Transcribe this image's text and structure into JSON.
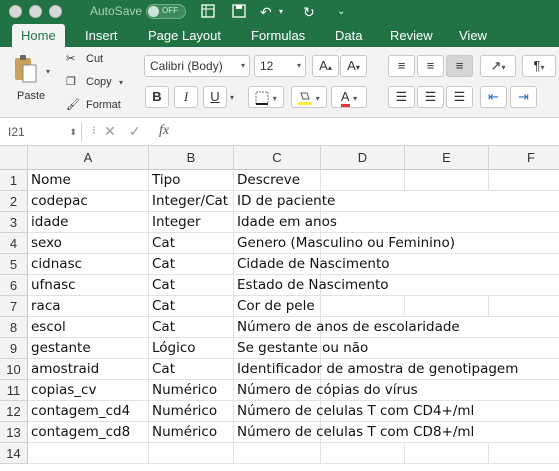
{
  "titlebar": {
    "autosave_label": "AutoSave",
    "toggle_state": "OFF"
  },
  "tabs": [
    "Home",
    "Insert",
    "Page Layout",
    "Formulas",
    "Data",
    "Review",
    "View"
  ],
  "ribbon": {
    "paste_label": "Paste",
    "cut_label": "Cut",
    "copy_label": "Copy",
    "format_label": "Format",
    "font_name": "Calibri (Body)",
    "font_size": "12",
    "bold": "B",
    "italic": "I",
    "underline": "U",
    "font_color": "#e53935",
    "fill_color": "#ffeb3b"
  },
  "formula_bar": {
    "name_box": "I21",
    "fx": "fx",
    "value": ""
  },
  "columns": [
    "A",
    "B",
    "C",
    "D",
    "E",
    "F"
  ],
  "rows": [
    {
      "num": "1",
      "a": "Nome",
      "b": "Tipo",
      "c": "Descreve"
    },
    {
      "num": "2",
      "a": "codepac",
      "b": "Integer/Cat",
      "c": "ID de paciente"
    },
    {
      "num": "3",
      "a": "idade",
      "b": "Integer",
      "c": "Idade em anos"
    },
    {
      "num": "4",
      "a": "sexo",
      "b": "Cat",
      "c": "Genero (Masculino ou Feminino)"
    },
    {
      "num": "5",
      "a": "cidnasc",
      "b": "Cat",
      "c": "Cidade de Nascimento"
    },
    {
      "num": "6",
      "a": "ufnasc",
      "b": "Cat",
      "c": "Estado de Nascimento"
    },
    {
      "num": "7",
      "a": "raca",
      "b": "Cat",
      "c": "Cor de pele"
    },
    {
      "num": "8",
      "a": "escol",
      "b": "Cat",
      "c": "Número de anos de escolaridade"
    },
    {
      "num": "9",
      "a": "gestante",
      "b": "Lógico",
      "c": "Se gestante ou não"
    },
    {
      "num": "10",
      "a": "amostraid",
      "b": "Cat",
      "c": "Identificador de amostra de genotipagem"
    },
    {
      "num": "11",
      "a": "copias_cv",
      "b": "Numérico",
      "c": "Número de cópias do vírus"
    },
    {
      "num": "12",
      "a": "contagem_cd4",
      "b": "Numérico",
      "c": "Número de celulas T com CD4+/ml"
    },
    {
      "num": "13",
      "a": "contagem_cd8",
      "b": "Numérico",
      "c": "Número de celulas T com CD8+/ml"
    },
    {
      "num": "14",
      "a": "",
      "b": "",
      "c": ""
    }
  ]
}
